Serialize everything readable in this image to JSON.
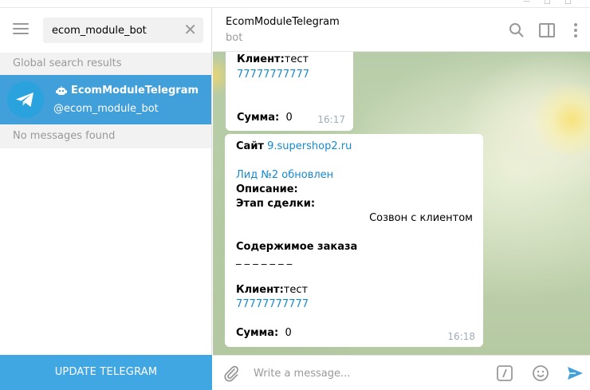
{
  "sidebar": {
    "search": {
      "value": "ecom_module_bot"
    },
    "global_results_label": "Global search results",
    "result": {
      "name": "EcomModuleTelegram",
      "handle": "@ecom_module_bot"
    },
    "no_messages_label": "No messages found",
    "update_button": "UPDATE TELEGRAM"
  },
  "chat": {
    "title": "EcomModuleTelegram",
    "subtitle": "bot",
    "messages": [
      {
        "client_label": "Клиент:",
        "client_value": "тест",
        "phone": "77777777777",
        "sum_label": "Сумма:",
        "sum_value": "0",
        "time": "16:17"
      },
      {
        "site_label": "Сайт",
        "site_link": "9.supershop2.ru",
        "lead_link": "Лид №2 обновлен",
        "description_label": "Описание:",
        "stage_label": "Этап сделки:",
        "stage_value": "Созвон с клиентом",
        "order_label": "Содержимое заказа",
        "order_dashes": "_ _ _ _ _ _ _",
        "client_label": "Клиент:",
        "client_value": "тест",
        "phone": "77777777777",
        "sum_label": "Сумма:",
        "sum_value": "0",
        "time": "16:18"
      }
    ]
  },
  "composer": {
    "placeholder": "Write a message..."
  },
  "colors": {
    "accent": "#419fd9",
    "link": "#168acd",
    "update_bg": "#40a7e3"
  }
}
